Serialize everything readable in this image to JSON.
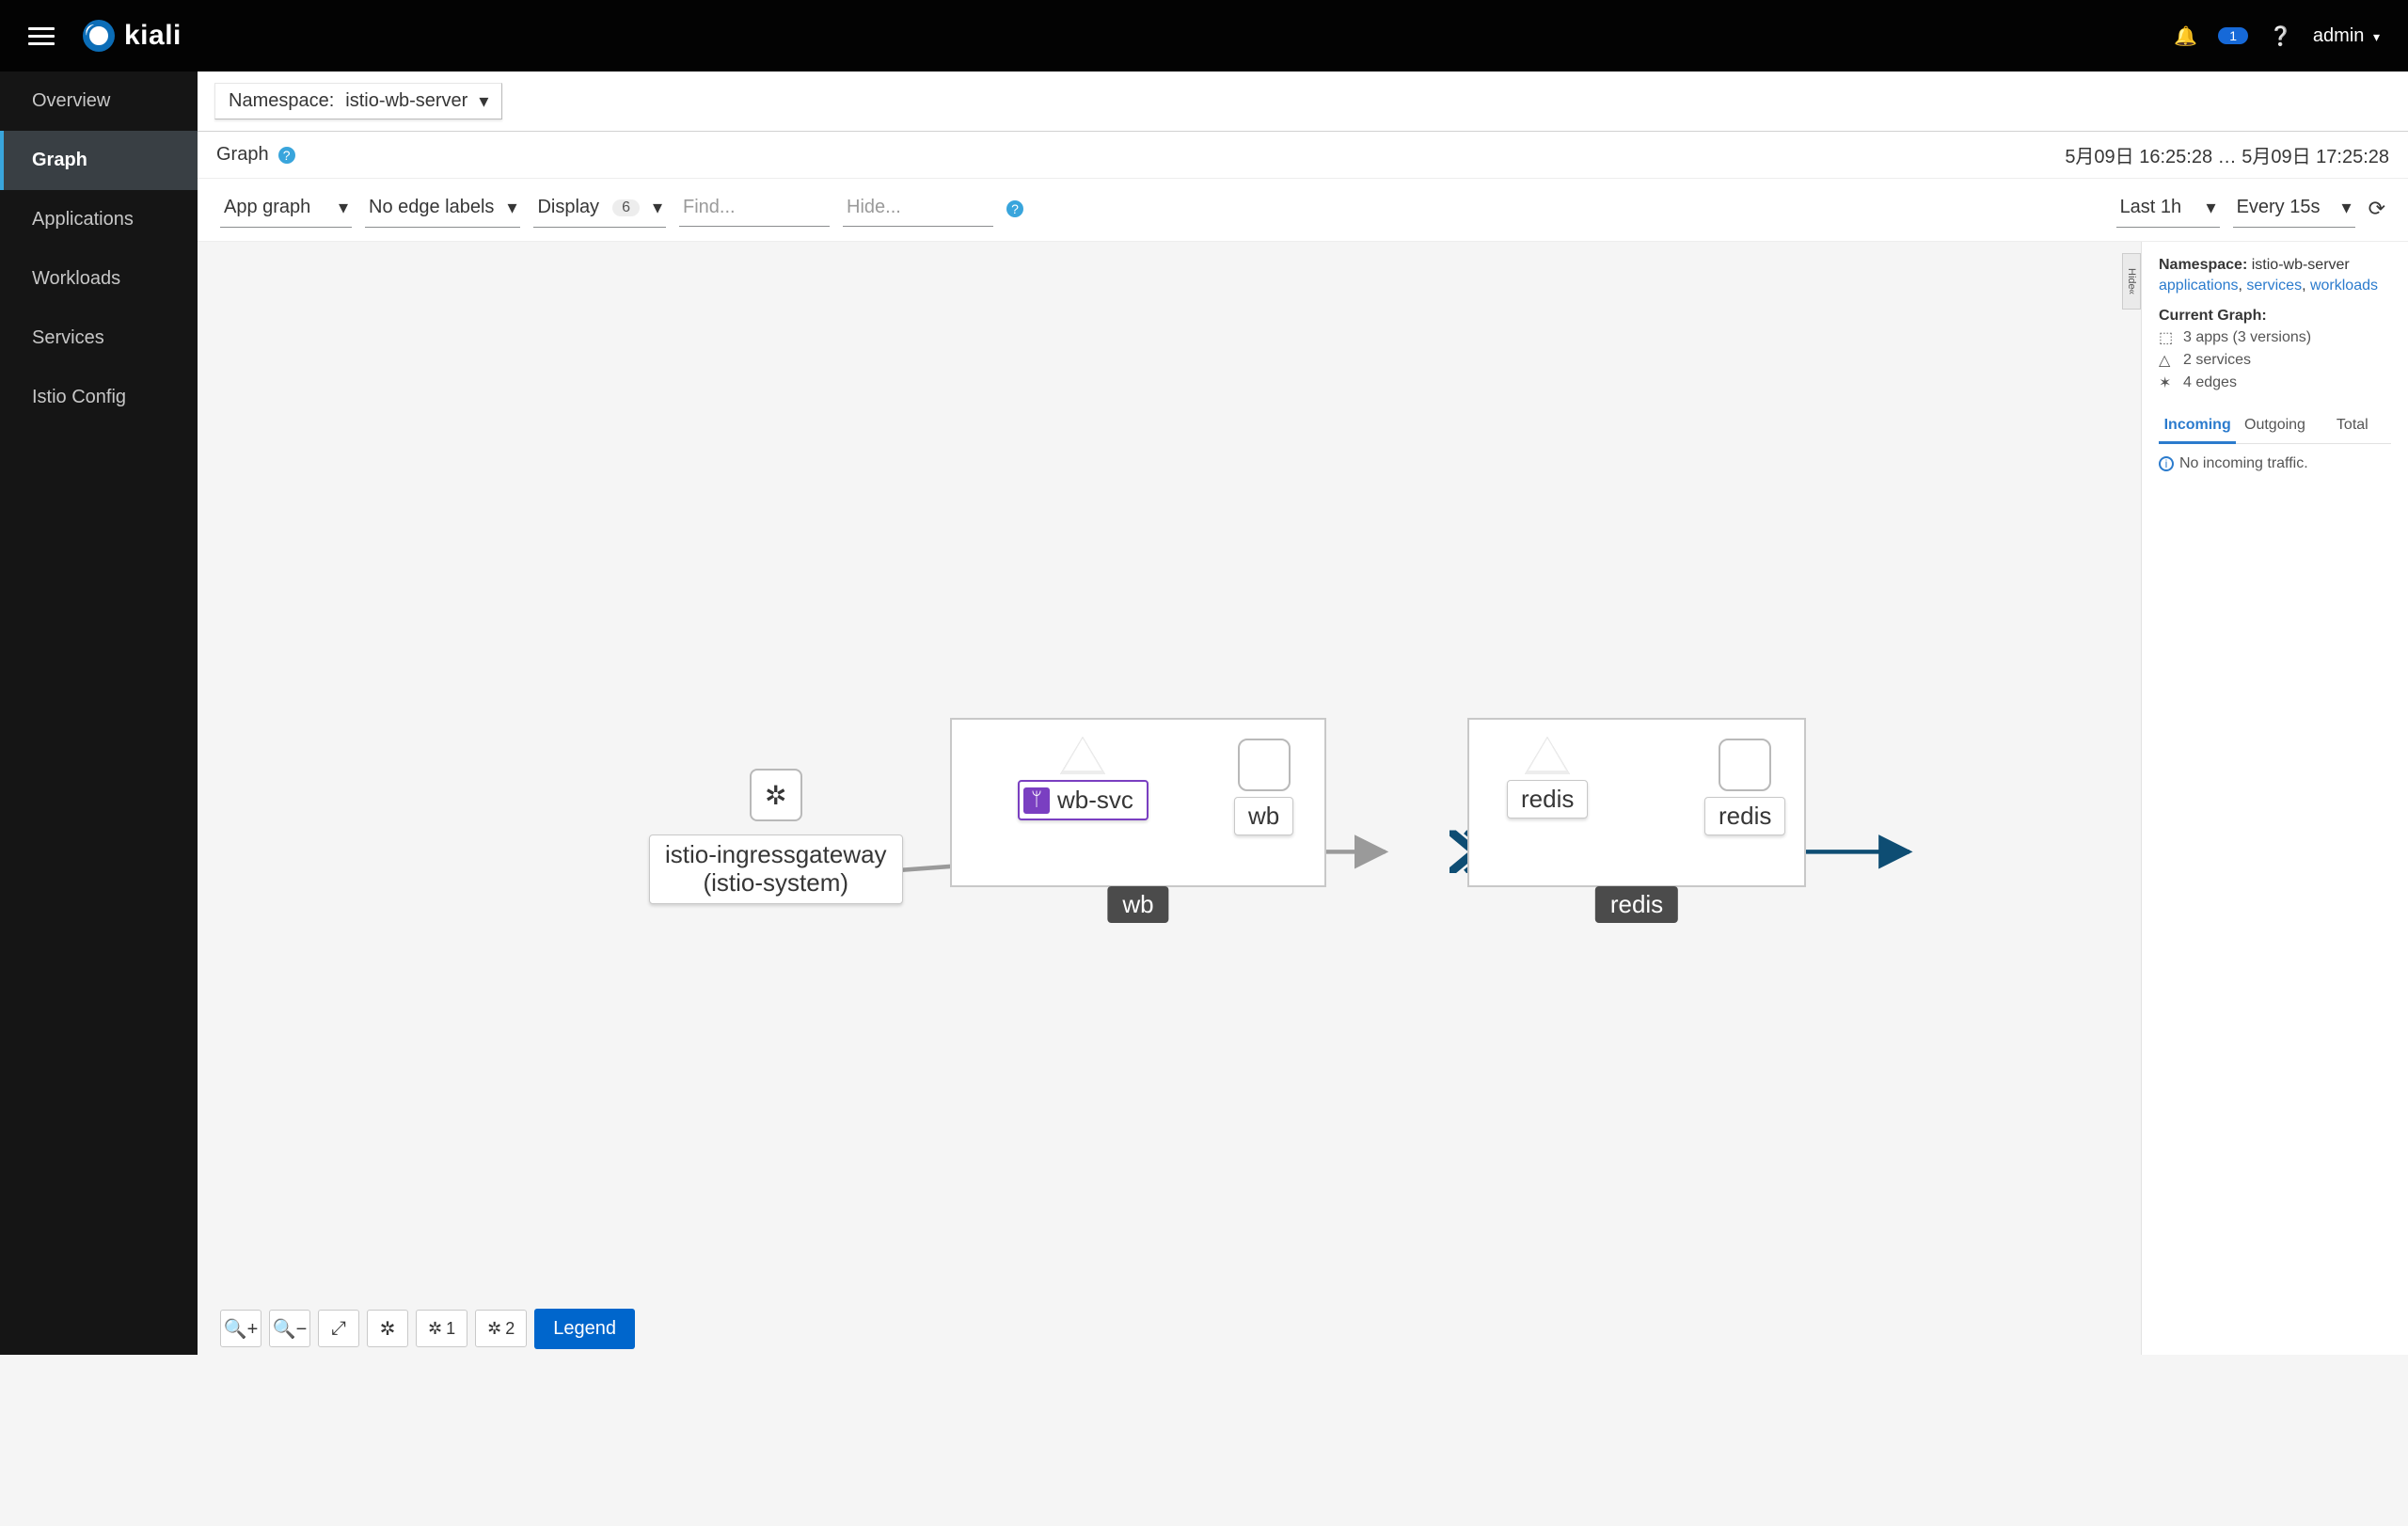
{
  "brand": {
    "name": "kiali"
  },
  "topbar": {
    "notification_count": "1",
    "user": "admin"
  },
  "sidenav": {
    "items": [
      {
        "label": "Overview",
        "active": false
      },
      {
        "label": "Graph",
        "active": true
      },
      {
        "label": "Applications",
        "active": false
      },
      {
        "label": "Workloads",
        "active": false
      },
      {
        "label": "Services",
        "active": false
      },
      {
        "label": "Istio Config",
        "active": false
      }
    ]
  },
  "namespace_selector": {
    "prefix": "Namespace:",
    "value": "istio-wb-server"
  },
  "breadcrumb": {
    "title": "Graph"
  },
  "time_range": {
    "from": "5月09日 16:25:28",
    "to": "5月09日 17:25:28",
    "sep": "…"
  },
  "toolbar": {
    "graph_type": "App graph",
    "edge_labels": "No edge labels",
    "display_label": "Display",
    "display_count": "6",
    "find_placeholder": "Find...",
    "hide_placeholder": "Hide...",
    "duration": "Last 1h",
    "refresh_interval": "Every 15s"
  },
  "info_panel": {
    "namespace_label": "Namespace:",
    "namespace_value": "istio-wb-server",
    "links": [
      "applications",
      "services",
      "workloads"
    ],
    "current_graph_label": "Current Graph:",
    "stats": {
      "apps": "3 apps (3 versions)",
      "services": "2 services",
      "edges": "4 edges"
    },
    "tabs": [
      "Incoming",
      "Outgoing",
      "Total"
    ],
    "active_tab": 0,
    "message": "No incoming traffic."
  },
  "hide_tab": "Hide",
  "bottombar": {
    "legend": "Legend",
    "layout1_label": "1",
    "layout2_label": "2"
  },
  "graph": {
    "gateway": {
      "label1": "istio-ingressgateway",
      "label2": "(istio-system)"
    },
    "group_wb": {
      "title": "wb",
      "svc": "wb-svc",
      "app": "wb"
    },
    "group_redis": {
      "title": "redis",
      "svc": "redis",
      "app": "redis"
    }
  },
  "colors": {
    "edge_idle": "#9a9a9a",
    "edge_tcp": "#0e4d73"
  },
  "watermark": ""
}
